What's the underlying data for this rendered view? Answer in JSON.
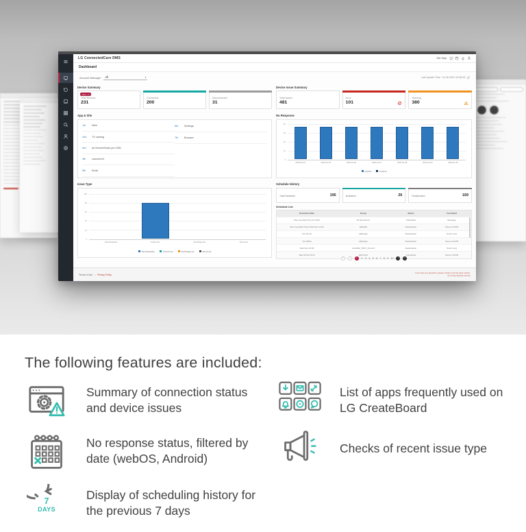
{
  "hero": {
    "dashboard": {
      "app_title": "LG ConnectedCare DMS",
      "header": {
        "site_map": "Site Map",
        "icons": [
          "chat-icon",
          "calendar-icon",
          "bell-icon",
          "user-icon"
        ],
        "last_update": "Last Update Time : 01.30.2023 10:38:28"
      },
      "page_title": "Dashboard",
      "filter": {
        "label": "Account Manager",
        "value": "All"
      },
      "sidebar": {
        "icons": [
          "menu-icon",
          "dashboard-icon",
          "history-icon",
          "device-icon",
          "apps-icon",
          "support-icon",
          "account-icon",
          "settings-icon"
        ],
        "active": "dashboard-icon"
      },
      "device_summary": {
        "title": "Device Summary",
        "badge": "New + 3",
        "cards": [
          {
            "label": "Total Devices",
            "value": "231",
            "accent": "",
            "icon": ""
          },
          {
            "label": "Connected",
            "value": "200",
            "accent": "#14a7a1",
            "icon": ""
          },
          {
            "label": "Disconnected",
            "value": "31",
            "accent": "#9b9b9b",
            "icon": ""
          }
        ]
      },
      "issue_summary": {
        "title": "Device Issue Summary",
        "cards": [
          {
            "label": "Total Issues",
            "value": "481",
            "accent": "",
            "icon": ""
          },
          {
            "label": "Error",
            "value": "101",
            "accent": "#c5271f",
            "icon": "error-icon"
          },
          {
            "label": "Warning",
            "value": "380",
            "accent": "#f0921d",
            "icon": "warning-icon"
          }
        ]
      },
      "app_site": {
        "title": "App & Site",
        "columns": [
          [
            {
              "rank": "1st",
              "name": "Web"
            },
            {
              "rank": "2nd",
              "name": "TV casting"
            },
            {
              "rank": "3rd",
              "name": "air.ScreenShare.per.OSD"
            },
            {
              "rank": "4th",
              "name": "Launcher3"
            },
            {
              "rank": "5th",
              "name": "Kiosk"
            }
          ],
          [
            {
              "rank": "6th",
              "name": "Settings"
            },
            {
              "rank": "7th",
              "name": "Browser"
            }
          ]
        ]
      },
      "no_response": {
        "title": "No Response",
        "chart_data": {
          "type": "bar",
          "x": [
            "2023-01-24",
            "2023-01-25",
            "2023-01-26",
            "2023-01-27",
            "2023-01-28",
            "2023-01-29",
            "2023-01-30"
          ],
          "values": [
            55,
            55,
            55,
            55,
            55,
            55,
            55
          ],
          "ylim": [
            0,
            60
          ],
          "yticks": [
            0,
            15,
            30,
            45,
            60
          ],
          "bar_color": "#2e79bd",
          "legend": [
            "webOS",
            "Android"
          ],
          "legend_colors": [
            "#2e79bd",
            "#0f3e66"
          ]
        }
      },
      "issue_type": {
        "title": "Issue Type",
        "chart_data": {
          "type": "bar",
          "categories": [
            "Panel/Speaker",
            "Check Fan",
            "Self Diagnosis",
            "Abnormal"
          ],
          "values": [
            0,
            80,
            0,
            0
          ],
          "ylim": [
            0,
            100
          ],
          "yticks": [
            0,
            20,
            40,
            60,
            80,
            100
          ],
          "bar_color": "#2e79bd",
          "legend": [
            "Panel/Speaker",
            "Check Fan",
            "Self Diagnosis",
            "Abnormal"
          ],
          "legend_colors": [
            "#2e79bd",
            "#17a2a0",
            "#f0921d",
            "#555555"
          ]
        }
      },
      "schedule": {
        "title": "Schedule History",
        "stats": [
          {
            "label": "Total Schedule",
            "value": "195",
            "accent": ""
          },
          {
            "label": "Activation",
            "value": "26",
            "accent": "#14a7a1"
          },
          {
            "label": "Deactivation",
            "value": "169",
            "accent": "#7c7c7c"
          }
        ],
        "list_title": "Schedule List",
        "table": {
          "headers": [
            "Execution Date",
            "Group",
            "Status",
            "Command"
          ],
          "rows": [
            [
              "Mon,Tue,Wed,Thu,Fri 13:00",
              "All (Smartcom)",
              "Scheduled",
              "Message"
            ],
            [
              "Mon,Tue,Wed,Thu,Fri,Sat,Sun 14:00",
              "adfsdfds",
              "Deactivation",
              "Screen On/Off"
            ],
            [
              "Sun 01:00",
              "QWodyj2",
              "Deactivation",
              "Touch Lock"
            ],
            [
              "Tue 08:02",
              "QWodyj2",
              "Deactivation",
              "Screen On/Off"
            ],
            [
              "Wed,Sun 10:00",
              "Anndfdts_TEST_yfrett.df",
              "Deactivation",
              "Touch Lock"
            ],
            [
              "Wed 16:10 15:30",
              "QWmnct2",
              "Completed",
              "Screen On/Off"
            ]
          ]
        },
        "pagination": {
          "prev": [
            "«",
            "‹"
          ],
          "pages": [
            "1",
            "2",
            "3",
            "4",
            "5",
            "6",
            "7",
            "8",
            "9",
            "10"
          ],
          "active": "1",
          "next": [
            "›",
            "»"
          ]
        }
      },
      "footer": {
        "links": [
          "Terms of Use",
          "Privacy Policy"
        ],
        "note": [
          "If you have any questions, please contact a service desk / Admin.",
          "by ConnectedCare Service"
        ]
      }
    }
  },
  "features": {
    "heading": "The following features are included:",
    "items": [
      {
        "icon": "browser-gear-warning-icon",
        "text": "Summary of connection status and device issues",
        "column": "left"
      },
      {
        "icon": "calendar-x-icon",
        "text": "No response status, filtered by date (webOS, Android)",
        "column": "left"
      },
      {
        "icon": "seven-days-icon",
        "text": "Display of scheduling history for the previous 7 days",
        "column": "left"
      },
      {
        "icon": "apps-grid-icon",
        "text": "List of apps frequently used on LG CreateBoard",
        "column": "right"
      },
      {
        "icon": "megaphone-icon",
        "text": "Checks of recent issue type",
        "column": "right"
      }
    ]
  }
}
